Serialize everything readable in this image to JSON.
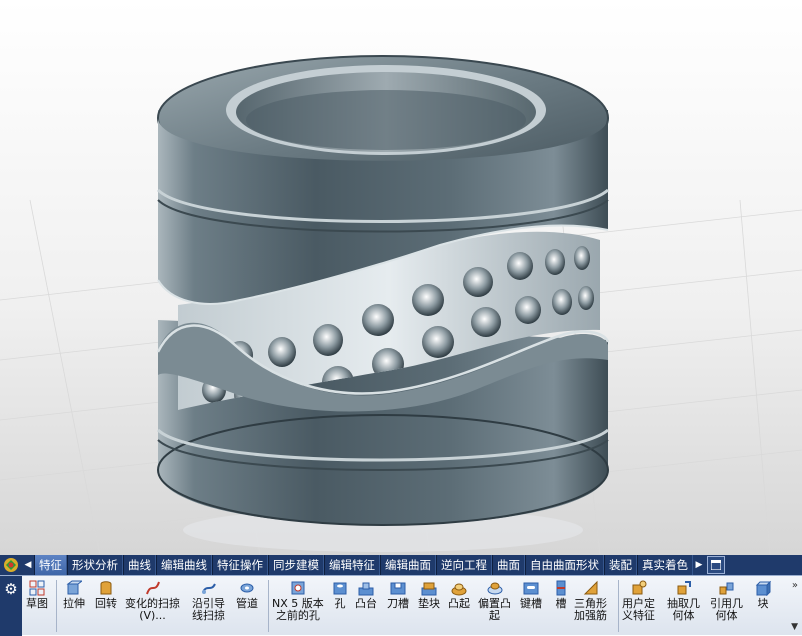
{
  "tabs": [
    "特征",
    "形状分析",
    "曲线",
    "编辑曲线",
    "特征操作",
    "同步建模",
    "编辑特征",
    "编辑曲面",
    "逆向工程",
    "曲面",
    "自由曲面形状",
    "装配",
    "真实着色"
  ],
  "active_tab": "特征",
  "tools": [
    {
      "label": "草图",
      "icon": "sketch-icon"
    },
    {
      "label": "拉伸",
      "icon": "extrude-icon"
    },
    {
      "label": "回转",
      "icon": "revolve-icon"
    },
    {
      "label": "变化的扫掠\n(V)...",
      "icon": "variational-sweep-icon"
    },
    {
      "label": "沿引导\n线扫掠",
      "icon": "sweep-along-guide-icon"
    },
    {
      "label": "管道",
      "icon": "tube-icon"
    },
    {
      "label": "NX 5 版本\n之前的孔",
      "icon": "legacy-hole-icon"
    },
    {
      "label": "孔",
      "icon": "hole-icon"
    },
    {
      "label": "凸台",
      "icon": "boss-icon"
    },
    {
      "label": "刀槽",
      "icon": "pocket-icon"
    },
    {
      "label": "垫块",
      "icon": "pad-icon"
    },
    {
      "label": "凸起",
      "icon": "emboss-icon"
    },
    {
      "label": "偏置凸\n起",
      "icon": "offset-emboss-icon"
    },
    {
      "label": "键槽",
      "icon": "slot-icon"
    },
    {
      "label": "槽",
      "icon": "groove-icon"
    },
    {
      "label": "三角形\n加强筋",
      "icon": "dart-icon"
    },
    {
      "label": "用户定\n义特征",
      "icon": "user-defined-feature-icon"
    },
    {
      "label": "抽取几\n何体",
      "icon": "extract-geometry-icon"
    },
    {
      "label": "引用几\n何体",
      "icon": "instance-geometry-icon"
    },
    {
      "label": "块",
      "icon": "block-icon"
    }
  ],
  "colors": {
    "ribbon": "#1f3a6b",
    "active_tab": "#4f75b8",
    "part": "#5e6f78"
  }
}
